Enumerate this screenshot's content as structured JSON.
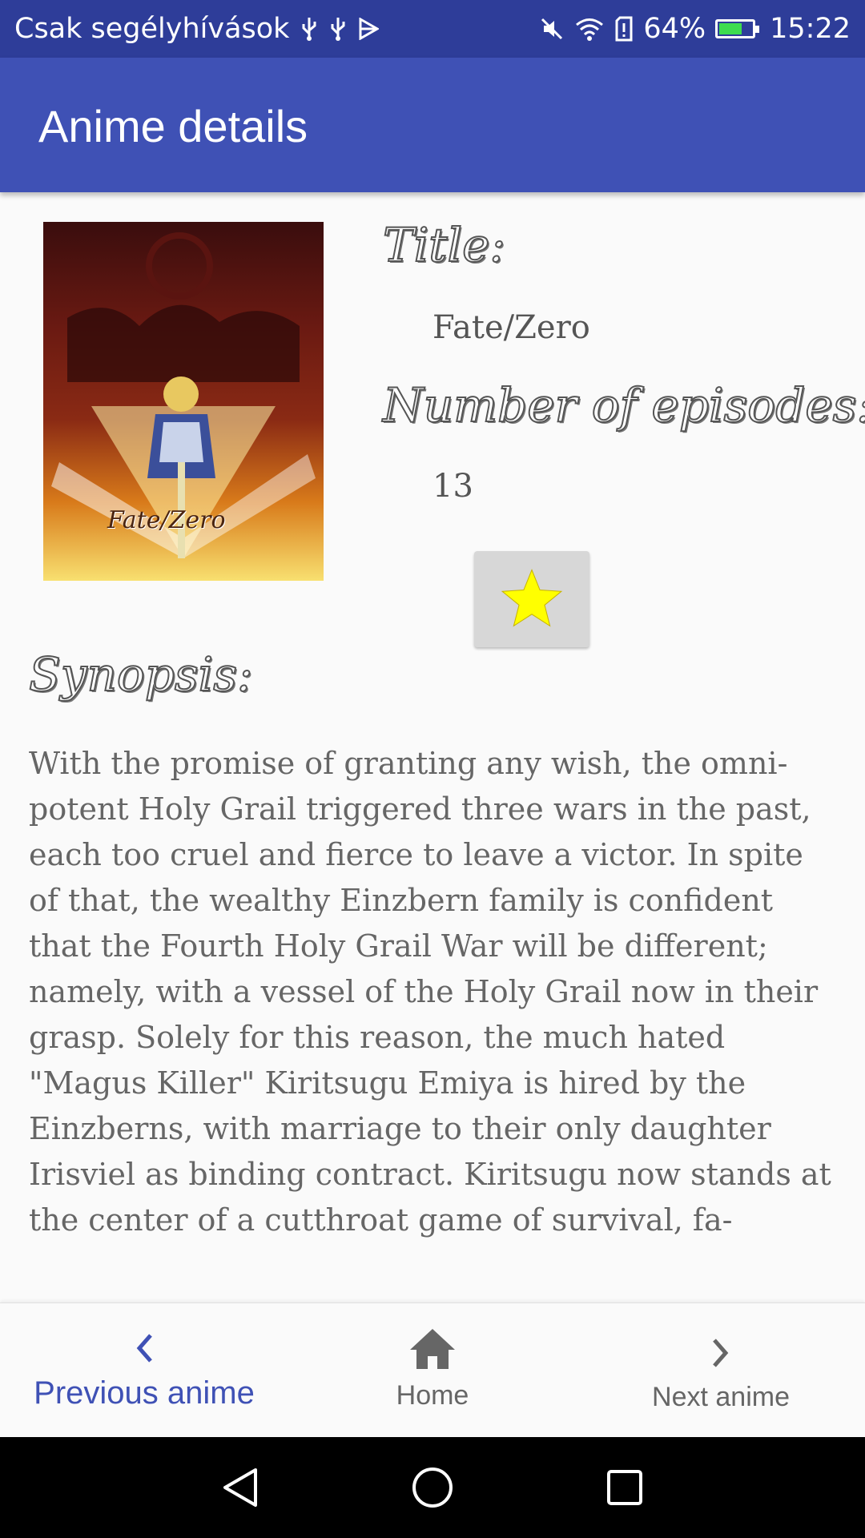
{
  "status_bar": {
    "carrier": "Csak segélyhívások",
    "battery": "64%",
    "time": "15:22",
    "icons": [
      "usb-icon",
      "usb-icon",
      "play-store-icon",
      "mute-icon",
      "wifi-icon",
      "sim-alert-icon",
      "battery-charging-icon"
    ]
  },
  "app_bar": {
    "title": "Anime details"
  },
  "details": {
    "title_label": "Title:",
    "title_value": "Fate/Zero",
    "episodes_label": "Number of episodes:",
    "episodes_value": "13",
    "poster_caption": "Fate/Zero",
    "favorite_icon": "star-icon",
    "favorite_color": "#ffff00"
  },
  "synopsis": {
    "label": "Synopsis:",
    "text": "With the promise of granting any wish, the omni-potent Holy Grail triggered three wars in the past, each too cruel and fierce to leave a victor. In spite of that, the wealthy Einzbern family is confident that the Fourth Holy Grail War will be different; namely, with a vessel of the Holy Grail now in their grasp. Solely for this reason, the much hated \"Magus Killer\" Kiritsugu Emiya is hired by the Einzberns, with marriage to their only daughter Irisviel as binding contract. Kiritsugu now stands at the center of a cutthroat game of survival, fa-"
  },
  "bottom_nav": {
    "items": [
      {
        "label": "Previous anime",
        "icon": "chevron-left-icon",
        "active": true
      },
      {
        "label": "Home",
        "icon": "home-icon",
        "active": false
      },
      {
        "label": "Next anime",
        "icon": "chevron-right-icon",
        "active": false
      }
    ],
    "active_color": "#3f51b5"
  },
  "system_nav": {
    "icons": [
      "back-icon",
      "home-circle-icon",
      "recents-icon"
    ]
  },
  "colors": {
    "status_bar": "#2e3d99",
    "app_bar": "#3f51b5",
    "background": "#fafafa"
  }
}
